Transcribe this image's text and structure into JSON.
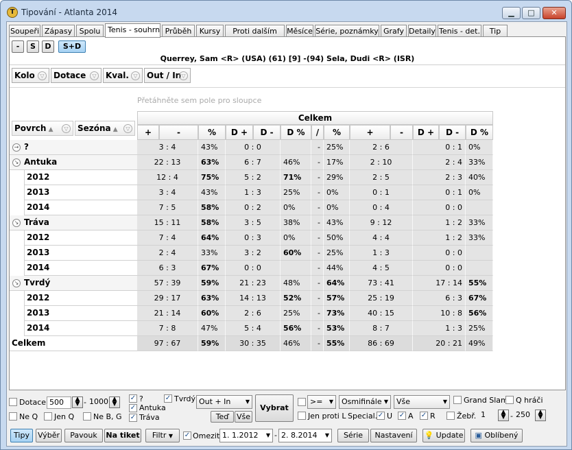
{
  "window": {
    "title": "Tipování - Atlanta 2014",
    "app_icon": "tennis-ball-icon",
    "controls": {
      "minimize": "▁",
      "maximize": "□",
      "close": "✕"
    }
  },
  "tabs": [
    "Soupeři",
    "Zápasy",
    "Spolu",
    "Tenis - souhrn",
    "Průběh",
    "Kursy",
    "Proti dalším",
    "Měsíce",
    "Série, poznámky",
    "Grafy",
    "Detaily",
    "Tenis - det.",
    "Tip"
  ],
  "selected_tab": "Tenis - souhrn",
  "segments": [
    "-",
    "S",
    "D",
    "S+D"
  ],
  "selected_segment": "S+D",
  "match": "Querrey, Sam <R> (USA) (61) [9] -(94) Sela, Dudi <R> (ISR)",
  "filter_fields": [
    "Kolo",
    "Dotace",
    "Kval.",
    "Out / In"
  ],
  "column_hint": "Přetáhněte sem pole pro sloupce",
  "row_fields": [
    "Povrch",
    "Sezóna"
  ],
  "column_group": "Celkem",
  "columns": [
    "+",
    "-",
    "%",
    "D +",
    "D -",
    "D %",
    "/",
    "%",
    "+",
    "-",
    "D +",
    "D -",
    "D %"
  ],
  "rows": [
    {
      "level": 1,
      "exp": "→",
      "label": "?",
      "v": [
        "3 : 4",
        "43%",
        "0 : 0",
        "",
        "-",
        "25%",
        "2 : 6",
        "0 : 1",
        "0%"
      ],
      "bold": []
    },
    {
      "level": 1,
      "exp": "↘",
      "label": "Antuka",
      "v": [
        "22 : 13",
        "63%",
        "6 : 7",
        "46%",
        "-",
        "17%",
        "2 : 10",
        "2 : 4",
        "33%"
      ],
      "bold": [
        1
      ]
    },
    {
      "level": 2,
      "label": "2012",
      "v": [
        "12 : 4",
        "75%",
        "5 : 2",
        "71%",
        "-",
        "29%",
        "2 : 5",
        "2 : 3",
        "40%"
      ],
      "bold": [
        1,
        3
      ]
    },
    {
      "level": 2,
      "label": "2013",
      "v": [
        "3 : 4",
        "43%",
        "1 : 3",
        "25%",
        "-",
        "0%",
        "0 : 1",
        "0 : 1",
        "0%"
      ],
      "bold": []
    },
    {
      "level": 2,
      "label": "2014",
      "v": [
        "7 : 5",
        "58%",
        "0 : 2",
        "0%",
        "-",
        "0%",
        "0 : 4",
        "0 : 0",
        ""
      ],
      "bold": [
        1
      ]
    },
    {
      "level": 1,
      "exp": "↘",
      "label": "Tráva",
      "v": [
        "15 : 11",
        "58%",
        "3 : 5",
        "38%",
        "-",
        "43%",
        "9 : 12",
        "1 : 2",
        "33%"
      ],
      "bold": [
        1
      ]
    },
    {
      "level": 2,
      "label": "2012",
      "v": [
        "7 : 4",
        "64%",
        "0 : 3",
        "0%",
        "-",
        "50%",
        "4 : 4",
        "1 : 2",
        "33%"
      ],
      "bold": [
        1
      ]
    },
    {
      "level": 2,
      "label": "2013",
      "v": [
        "2 : 4",
        "33%",
        "3 : 2",
        "60%",
        "-",
        "25%",
        "1 : 3",
        "0 : 0",
        ""
      ],
      "bold": [
        3
      ]
    },
    {
      "level": 2,
      "label": "2014",
      "v": [
        "6 : 3",
        "67%",
        "0 : 0",
        "",
        "-",
        "44%",
        "4 : 5",
        "0 : 0",
        ""
      ],
      "bold": [
        1
      ]
    },
    {
      "level": 1,
      "exp": "↘",
      "label": "Tvrdý",
      "v": [
        "57 : 39",
        "59%",
        "21 : 23",
        "48%",
        "-",
        "64%",
        "73 : 41",
        "17 : 14",
        "55%"
      ],
      "bold": [
        1,
        5,
        8
      ]
    },
    {
      "level": 2,
      "label": "2012",
      "v": [
        "29 : 17",
        "63%",
        "14 : 13",
        "52%",
        "-",
        "57%",
        "25 : 19",
        "6 : 3",
        "67%"
      ],
      "bold": [
        1,
        3,
        5,
        8
      ]
    },
    {
      "level": 2,
      "label": "2013",
      "v": [
        "21 : 14",
        "60%",
        "2 : 6",
        "25%",
        "-",
        "73%",
        "40 : 15",
        "10 : 8",
        "56%"
      ],
      "bold": [
        1,
        5,
        8
      ]
    },
    {
      "level": 2,
      "label": "2014",
      "v": [
        "7 : 8",
        "47%",
        "5 : 4",
        "56%",
        "-",
        "53%",
        "8 : 7",
        "1 : 3",
        "25%"
      ],
      "bold": [
        3,
        5
      ]
    },
    {
      "level": 0,
      "label": "Celkem",
      "v": [
        "97 : 67",
        "59%",
        "30 : 35",
        "46%",
        "-",
        "55%",
        "86 : 69",
        "20 : 21",
        "49%"
      ],
      "bold": [
        1,
        5
      ]
    }
  ],
  "bottom": {
    "dotace_label": "Dotace",
    "dotace_from": "500",
    "dotace_to": "1000",
    "neq_label": "Ne Q",
    "jenq_label": "Jen Q",
    "nebg_label": "Ne B, G",
    "q_label": "?",
    "antuka_label": "Antuka",
    "trava_label": "Tráva",
    "tvrdy_label": "Tvrdý",
    "outin_value": "Out + In",
    "ted_label": "Teď",
    "vse_label": "Vše",
    "vybrat_label": "Vybrat",
    "op_value": ">=",
    "round_value": "Osmifinále",
    "vse_select": "Vše",
    "jenprotil_label": "Jen proti L",
    "special_label": "Special.",
    "u_label": "U",
    "a_label": "A",
    "r_label": "R",
    "grandslam_label": "Grand Slam",
    "qhraci_label": "Q hráči",
    "zebr_label": "Žebř.",
    "zebr_from": "1",
    "zebr_to": "250",
    "tipy_label": "Tipy",
    "vyber_label": "Výběr",
    "pavouk_label": "Pavouk",
    "natiket_label": "Na tiket",
    "filtr_label": "Filtr",
    "omezit_label": "Omezit",
    "date_from": "1.  1.2012",
    "date_to": "2.  8.2014",
    "serie_label": "Série",
    "nastaveni_label": "Nastavení",
    "update_label": "Update",
    "oblibeny_label": "Oblíbený"
  }
}
